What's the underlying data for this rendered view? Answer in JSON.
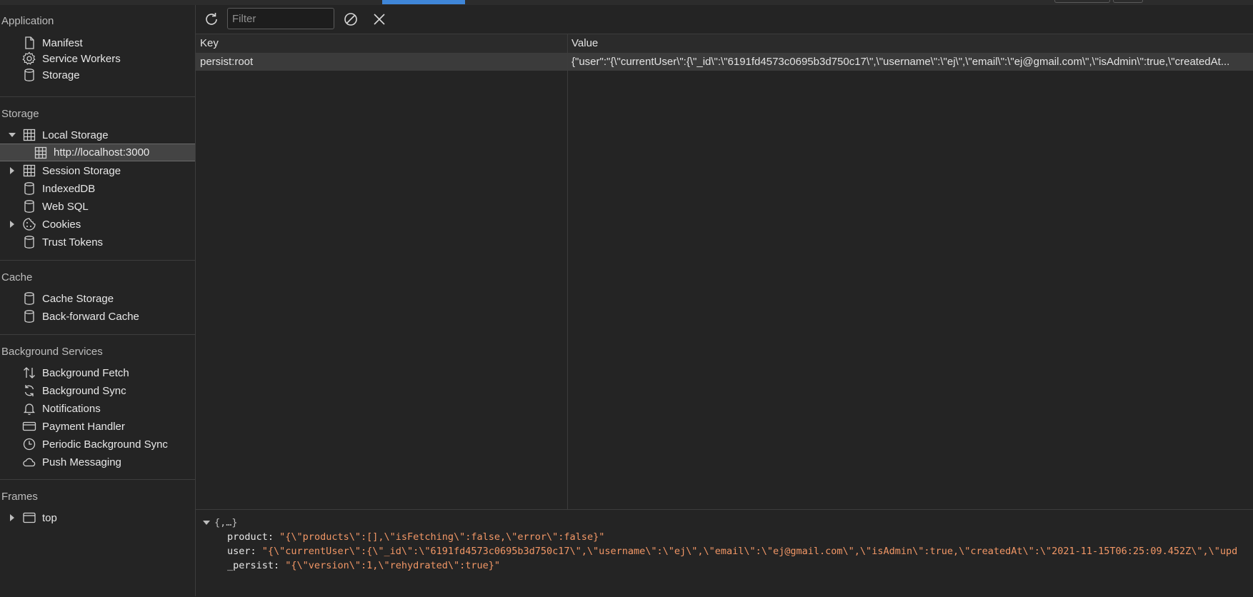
{
  "sidebar": {
    "application_title": "Application",
    "application_items": [
      {
        "label": "Manifest",
        "icon": "file-icon"
      },
      {
        "label": "Service Workers",
        "icon": "gear-icon"
      },
      {
        "label": "Storage",
        "icon": "database-icon"
      }
    ],
    "storage_title": "Storage",
    "storage_items": {
      "local_storage": "Local Storage",
      "local_origin": "http://localhost:3000",
      "session_storage": "Session Storage",
      "indexeddb": "IndexedDB",
      "websql": "Web SQL",
      "cookies": "Cookies",
      "trust_tokens": "Trust Tokens"
    },
    "cache_title": "Cache",
    "cache_items": {
      "cache_storage": "Cache Storage",
      "back_forward": "Back-forward Cache"
    },
    "bg_title": "Background Services",
    "bg_items": {
      "fetch": "Background Fetch",
      "sync": "Background Sync",
      "notifications": "Notifications",
      "payment": "Payment Handler",
      "periodic": "Periodic Background Sync",
      "push": "Push Messaging"
    },
    "frames_title": "Frames",
    "frames_top": "top"
  },
  "toolbar": {
    "filter_placeholder": "Filter",
    "refresh_icon": "refresh-icon",
    "clear_all_icon": "block-icon",
    "delete_icon": "close-icon"
  },
  "table": {
    "key_header": "Key",
    "value_header": "Value",
    "rows": [
      {
        "key": "persist:root",
        "value": "{\"user\":\"{\\\"currentUser\\\":{\\\"_id\\\":\\\"6191fd4573c0695b3d750c17\\\",\\\"username\\\":\\\"ej\\\",\\\"email\\\":\\\"ej@gmail.com\\\",\\\"isAdmin\\\":true,\\\"createdAt..."
      }
    ]
  },
  "preview": {
    "root": "{,…}",
    "product_key": "product:",
    "product_val": "\"{\\\"products\\\":[],\\\"isFetching\\\":false,\\\"error\\\":false}\"",
    "user_key": "user:",
    "user_val": "\"{\\\"currentUser\\\":{\\\"_id\\\":\\\"6191fd4573c0695b3d750c17\\\",\\\"username\\\":\\\"ej\\\",\\\"email\\\":\\\"ej@gmail.com\\\",\\\"isAdmin\\\":true,\\\"createdAt\\\":\\\"2021-11-15T06:25:09.452Z\\\",\\\"upd",
    "persist_key": "_persist:",
    "persist_val": "\"{\\\"version\\\":1,\\\"rehydrated\\\":true}\""
  }
}
